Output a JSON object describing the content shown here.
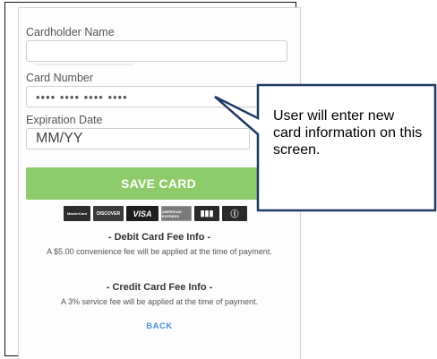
{
  "form": {
    "cardholder_label": "Cardholder Name",
    "cardholder_value": "",
    "card_number_label": "Card Number",
    "card_number_placeholder": "•••• •••• •••• ••••",
    "expiration_label": "Expiration Date",
    "expiration_placeholder": "MM/YY",
    "save_label": "SAVE CARD"
  },
  "card_logos": [
    {
      "name": "mastercard",
      "text": "MasterCard"
    },
    {
      "name": "discover",
      "text": "DISCOVER"
    },
    {
      "name": "visa",
      "text": "VISA"
    },
    {
      "name": "american-express",
      "text": "AMERICAN EXPRESS"
    },
    {
      "name": "bank",
      "text": "▮▮▮"
    },
    {
      "name": "other",
      "text": "Ⓘ"
    }
  ],
  "fees": {
    "debit_title": "- Debit Card Fee Info -",
    "debit_text": "A $5.00 convenience fee will be applied at the time of payment.",
    "credit_title": "- Credit Card Fee Info -",
    "credit_text": "A 3% service fee will be applied at the time of payment."
  },
  "back_label": "BACK",
  "callout": {
    "text": "User will enter new card information on this screen."
  },
  "colors": {
    "save_button": "#8ecb6a",
    "back_link": "#4a90d9",
    "callout_border": "#1f3a66"
  }
}
